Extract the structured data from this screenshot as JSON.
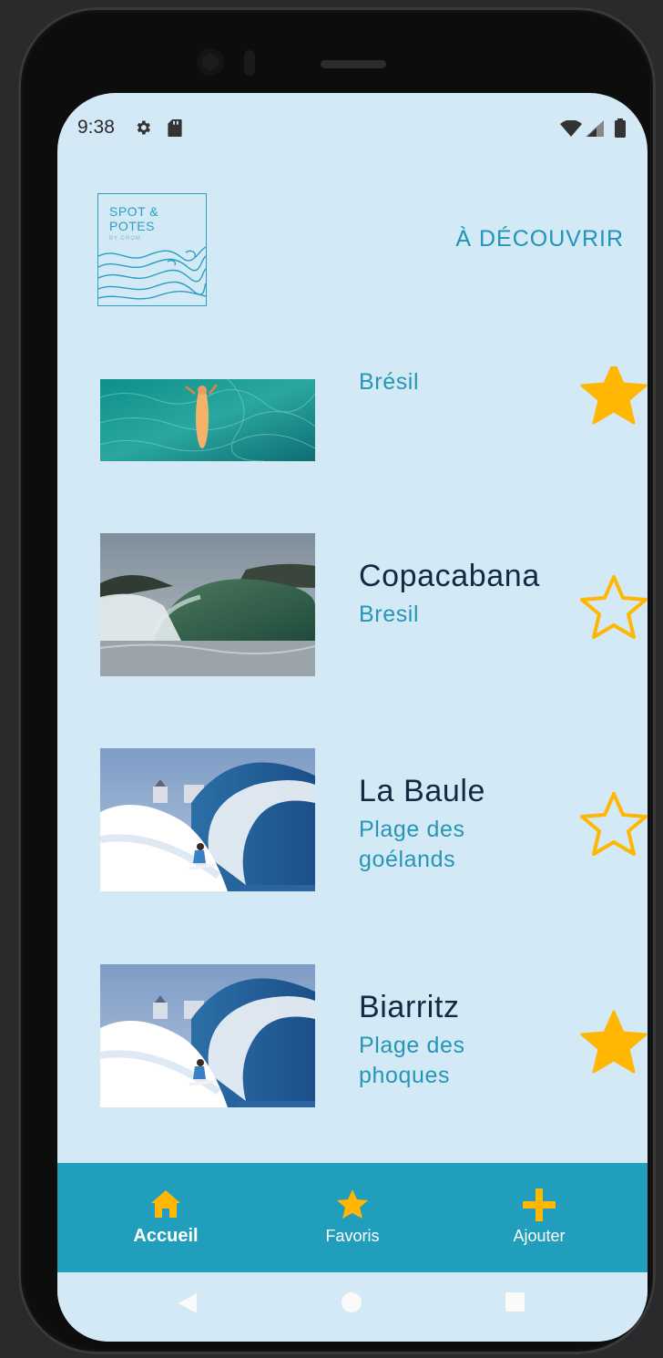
{
  "status_bar": {
    "time": "9:38"
  },
  "header": {
    "logo": {
      "line1": "SPOT &",
      "line2": "POTES",
      "tagline": "BY CROM"
    },
    "discover_label": "À DÉCOUVRIR"
  },
  "spots": [
    {
      "name": "",
      "location": "Brésil",
      "favorite": true,
      "image": "turquoise-water-surfer"
    },
    {
      "name": "Copacabana",
      "location": "Bresil",
      "favorite": false,
      "image": "green-barrel-wave"
    },
    {
      "name": "La Baule",
      "location": "Plage des goélands",
      "favorite": false,
      "image": "blue-wave-surfer"
    },
    {
      "name": "Biarritz",
      "location": "Plage des phoques",
      "favorite": true,
      "image": "blue-wave-surfer"
    }
  ],
  "tabs": [
    {
      "label": "Accueil",
      "icon": "home-icon",
      "active": true
    },
    {
      "label": "Favoris",
      "icon": "star-icon",
      "active": false
    },
    {
      "label": "Ajouter",
      "icon": "plus-icon",
      "active": false
    }
  ],
  "colors": {
    "background": "#d3e9f5",
    "accent": "#219ebc",
    "star": "#ffb703",
    "title": "#0f2b44",
    "subtitle": "#2596b6"
  }
}
